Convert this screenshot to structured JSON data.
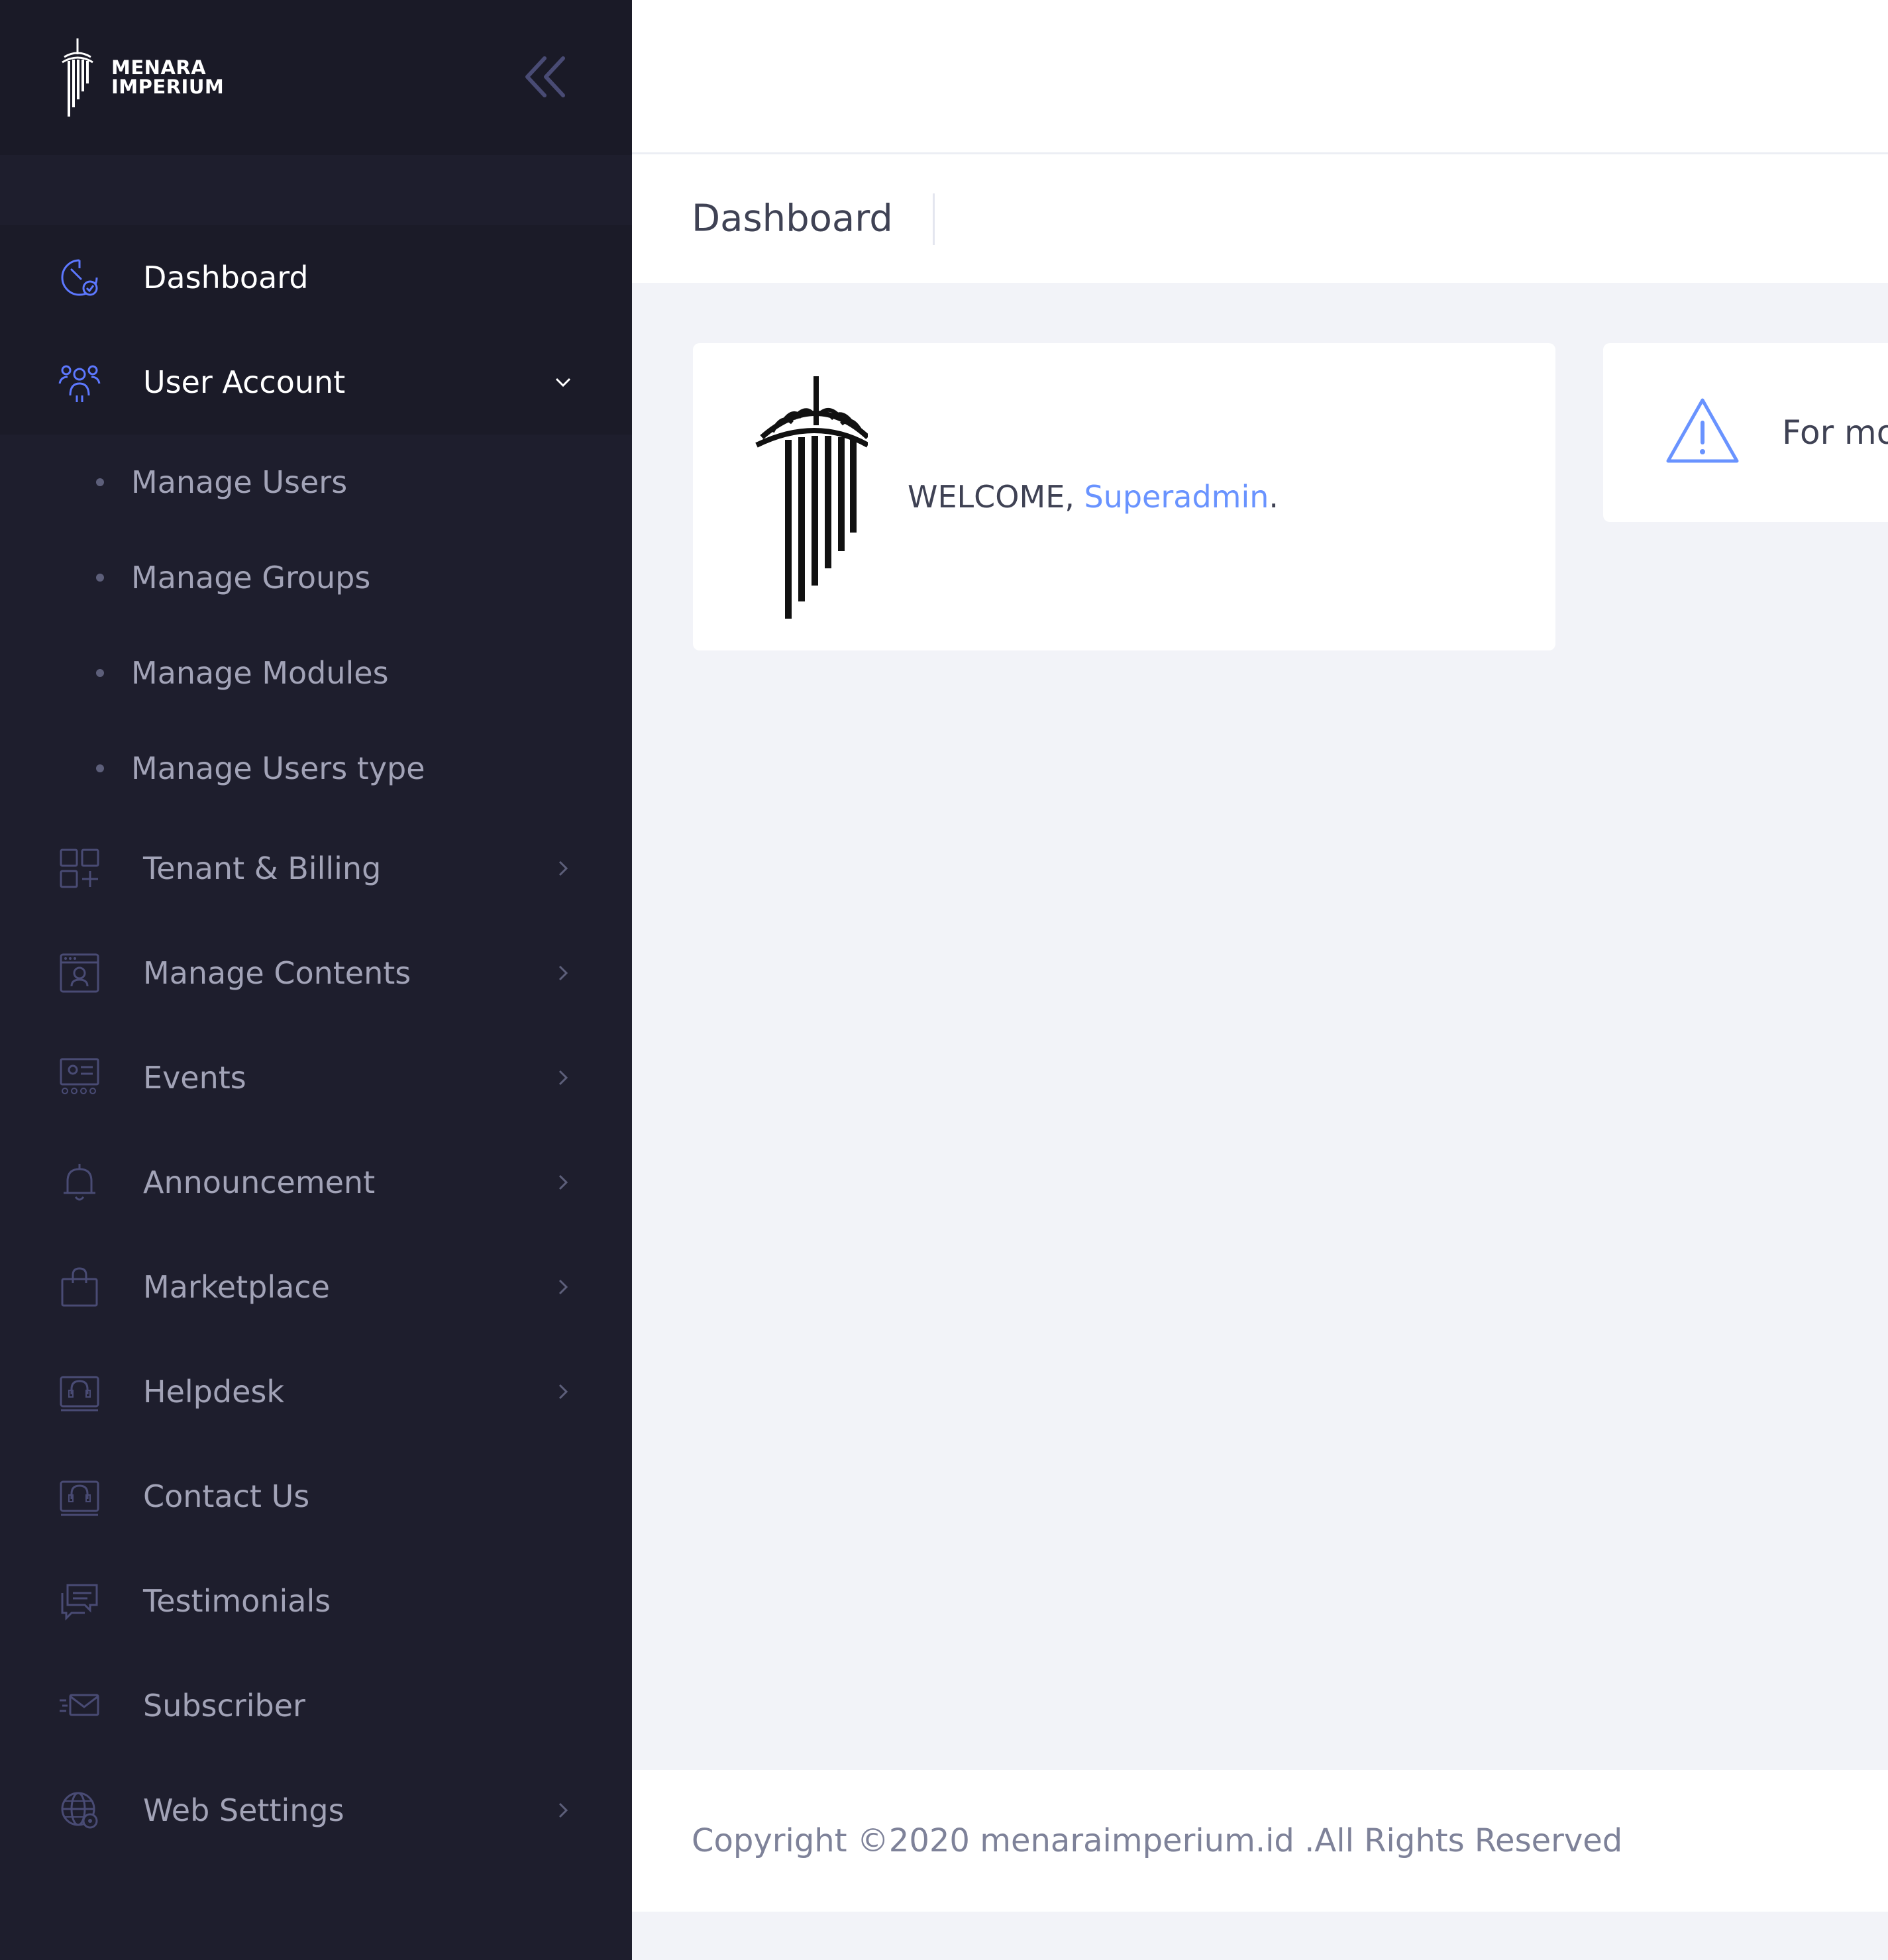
{
  "brand": {
    "line1": "MENARA",
    "line2": "IMPERIUM"
  },
  "colors": {
    "sidebar_bg": "#1e1e2d",
    "brand_bg": "#1a1a27",
    "accent": "#6993ff",
    "icon_active": "#5d78ff",
    "icon_muted": "#494b74",
    "text_muted": "#a2a3b7"
  },
  "sidebar": {
    "items": [
      {
        "label": "Dashboard",
        "icon": "dashboard-icon"
      },
      {
        "label": "User Account",
        "icon": "users-icon",
        "expanded": true,
        "children": [
          {
            "label": "Manage Users"
          },
          {
            "label": "Manage Groups"
          },
          {
            "label": "Manage Modules"
          },
          {
            "label": "Manage Users type"
          }
        ]
      },
      {
        "label": "Tenant & Billing",
        "icon": "grid-plus-icon"
      },
      {
        "label": "Manage Contents",
        "icon": "browser-content-icon"
      },
      {
        "label": "Events",
        "icon": "events-icon"
      },
      {
        "label": "Announcement",
        "icon": "bell-icon"
      },
      {
        "label": "Marketplace",
        "icon": "shopping-bag-icon"
      },
      {
        "label": "Helpdesk",
        "icon": "headset-icon"
      },
      {
        "label": "Contact Us",
        "icon": "contact-headset-icon"
      },
      {
        "label": "Testimonials",
        "icon": "chat-bubbles-icon"
      },
      {
        "label": "Subscriber",
        "icon": "envelope-send-icon"
      },
      {
        "label": "Web Settings",
        "icon": "globe-settings-icon"
      }
    ]
  },
  "subheader": {
    "title": "Dashboard"
  },
  "welcome": {
    "greeting": "WELCOME, ",
    "name": "Superadmin",
    "suffix": "."
  },
  "alert": {
    "icon": "warning-triangle-icon",
    "text": "For mo"
  },
  "footer": {
    "copyright": "Copyright ©2020 menaraimperium.id .All Rights Reserved"
  }
}
